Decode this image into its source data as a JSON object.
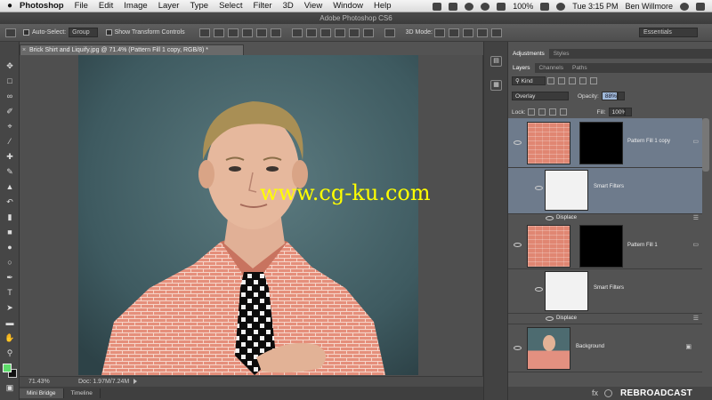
{
  "menubar": {
    "app": "Photoshop",
    "items": [
      "File",
      "Edit",
      "Image",
      "Layer",
      "Type",
      "Select",
      "Filter",
      "3D",
      "View",
      "Window",
      "Help"
    ],
    "battery": "100%",
    "clock": "Tue 3:15 PM",
    "user": "Ben Willmore"
  },
  "window": {
    "title": "Adobe Photoshop CS6"
  },
  "options": {
    "auto_select": "Auto-Select:",
    "auto_select_value": "Group",
    "show_transform": "Show Transform Controls",
    "mode_3d": "3D Mode:",
    "workspace": "Essentials"
  },
  "document": {
    "tab_title": "Brick Shirt and Liquify.jpg @ 71.4% (Pattern Fill 1 copy, RGB/8) *",
    "zoom": "71.43%",
    "doc_size": "Doc: 1.97M/7.24M"
  },
  "bottom_tabs": [
    "Mini Bridge",
    "Timeline"
  ],
  "panels": {
    "top_tabs": [
      "Adjustments",
      "Styles"
    ],
    "layer_tabs": [
      "Layers",
      "Channels",
      "Paths"
    ],
    "kind_label": "Kind",
    "blend_mode": "Overlay",
    "opacity_label": "Opacity:",
    "opacity_value": "88%",
    "lock_label": "Lock:",
    "fill_label": "Fill:",
    "fill_value": "100%"
  },
  "layers": [
    {
      "name": "Pattern Fill 1 copy",
      "selected": true
    },
    {
      "name": "Smart Filters"
    },
    {
      "name": "Displace"
    },
    {
      "name": "Pattern Fill 1"
    },
    {
      "name": "Smart Filters"
    },
    {
      "name": "Displace"
    },
    {
      "name": "Background"
    }
  ],
  "overlay": {
    "watermark": "www.cg-ku.com",
    "broadcast": "REBROADCAST"
  },
  "colors": {
    "foreground": "#5ddc6a",
    "background": "#111111",
    "shirt_pattern": "#e08672",
    "selection": "#6e7b8c",
    "watermark": "#ffff00"
  }
}
